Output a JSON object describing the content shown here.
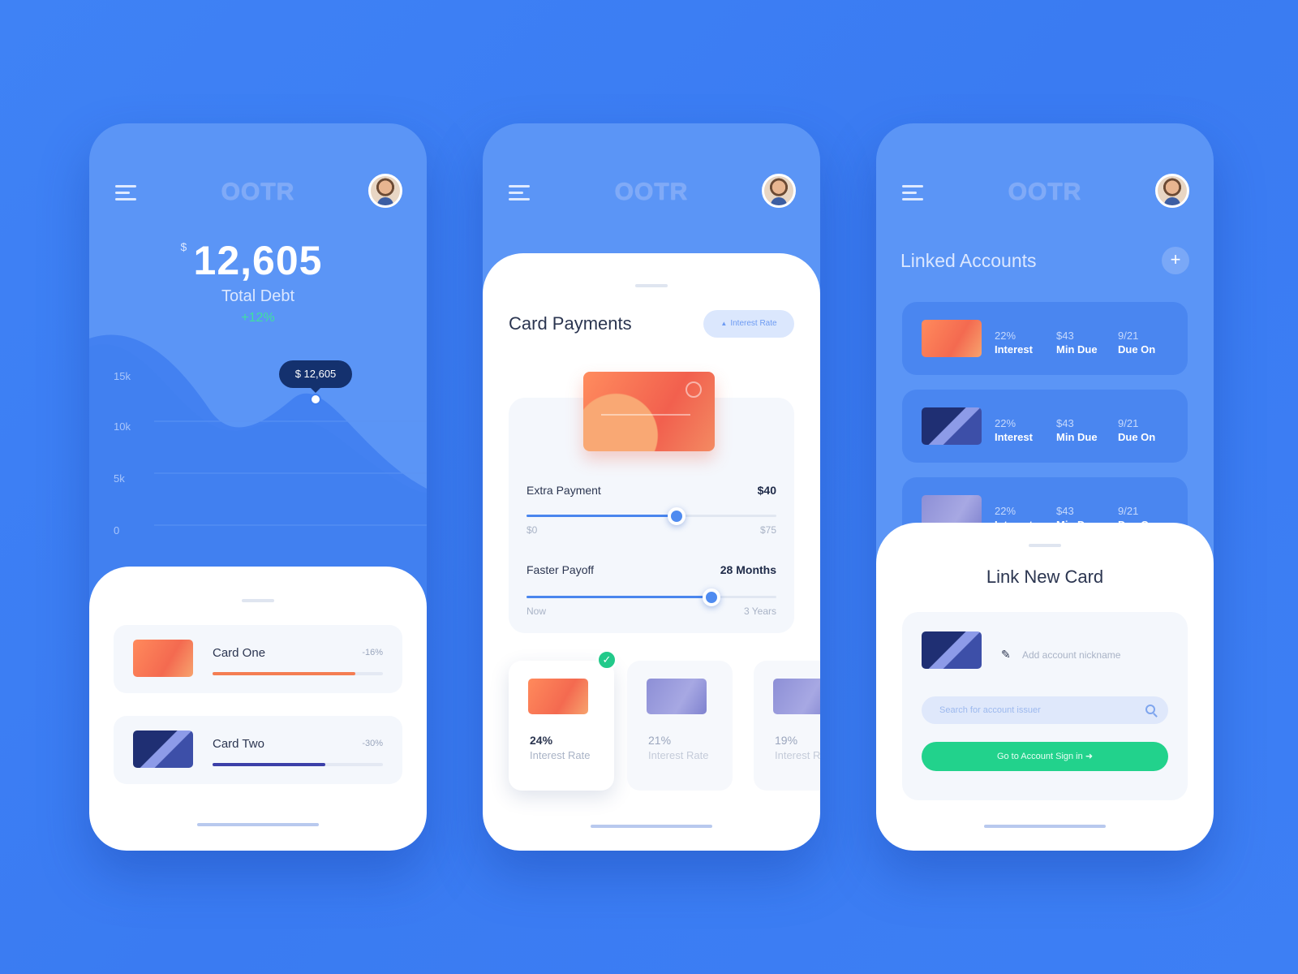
{
  "app": {
    "logo": "OOTR"
  },
  "colors": {
    "background": "#3d7ff4",
    "accent_green": "#22d28c",
    "card_orange": "#f46a50",
    "card_navy": "#1f2f73",
    "primary_blue": "#4a86ee"
  },
  "screen1": {
    "currency": "$",
    "total_amount": "12,605",
    "total_label": "Total Debt",
    "total_change": "+12%",
    "tooltip": "$ 12,605",
    "y_axis": [
      "15k",
      "10k",
      "5k",
      "0"
    ],
    "cards": [
      {
        "name": "Card One",
        "pct": "-16%",
        "progress": 0.84,
        "color": "#f47d52"
      },
      {
        "name": "Card Two",
        "pct": "-30%",
        "progress": 0.66,
        "color": "#3b3fa8"
      }
    ]
  },
  "screen2": {
    "title": "Card Payments",
    "filter_label": "Interest Rate",
    "extra_payment": {
      "label": "Extra Payment",
      "value": "$40",
      "min": "$0",
      "max": "$75",
      "level": 0.6
    },
    "faster_payoff": {
      "label": "Faster Payoff",
      "value": "28 Months",
      "min": "Now",
      "max": "3 Years",
      "level": 0.74
    },
    "rate_cards": [
      {
        "pct": "24%",
        "label": "Interest Rate",
        "selected": true
      },
      {
        "pct": "21%",
        "label": "Interest Rate",
        "selected": false
      },
      {
        "pct": "19%",
        "label": "Interest Rate",
        "selected": false
      }
    ]
  },
  "screen3": {
    "title": "Linked Accounts",
    "accounts": [
      {
        "interest": "22%",
        "interest_label": "Interest",
        "min_due": "$43",
        "min_due_label": "Min Due",
        "due_on": "9/21",
        "due_on_label": "Due On"
      },
      {
        "interest": "22%",
        "interest_label": "Interest",
        "min_due": "$43",
        "min_due_label": "Min Due",
        "due_on": "9/21",
        "due_on_label": "Due On"
      },
      {
        "interest": "22%",
        "interest_label": "Interest",
        "min_due": "$43",
        "min_due_label": "Min Due",
        "due_on": "9/21",
        "due_on_label": "Due On"
      }
    ],
    "link_card": {
      "title": "Link New Card",
      "nickname_placeholder": "Add account nickname",
      "search_placeholder": "Search for account issuer",
      "button_label": "Go to Account Sign in"
    }
  }
}
